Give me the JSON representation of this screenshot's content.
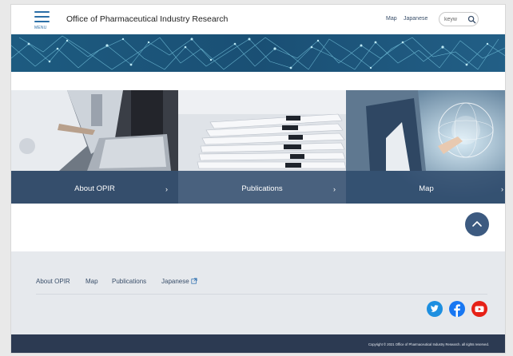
{
  "header": {
    "menu_label": "MENU",
    "site_title": "Office of Pharmaceutical Industry Research",
    "map_link": "Map",
    "japanese_link": "Japanese",
    "search": {
      "value": "keyw"
    }
  },
  "tiles": [
    {
      "label": "About OPIR",
      "chevron": "›"
    },
    {
      "label": "Publications",
      "chevron": "›"
    },
    {
      "label": "Map",
      "chevron": "›"
    }
  ],
  "footer": {
    "nav": [
      "About OPIR",
      "Map",
      "Publications",
      "Japanese"
    ],
    "copyright": "Copyright © 2021 Office of Pharmaceutical Industry Research. all rights reserved."
  },
  "social": [
    {
      "icon": "twitter-icon",
      "color": "#1d8fe0"
    },
    {
      "icon": "facebook-icon",
      "color": "#1877f2"
    },
    {
      "icon": "youtube-icon",
      "color": "#e62117"
    }
  ],
  "colors": {
    "accent": "#2a6ea6",
    "tile_overlay": "#284466",
    "footer_bg": "#e6e9ed",
    "copyright_bg": "#2c3a52"
  }
}
